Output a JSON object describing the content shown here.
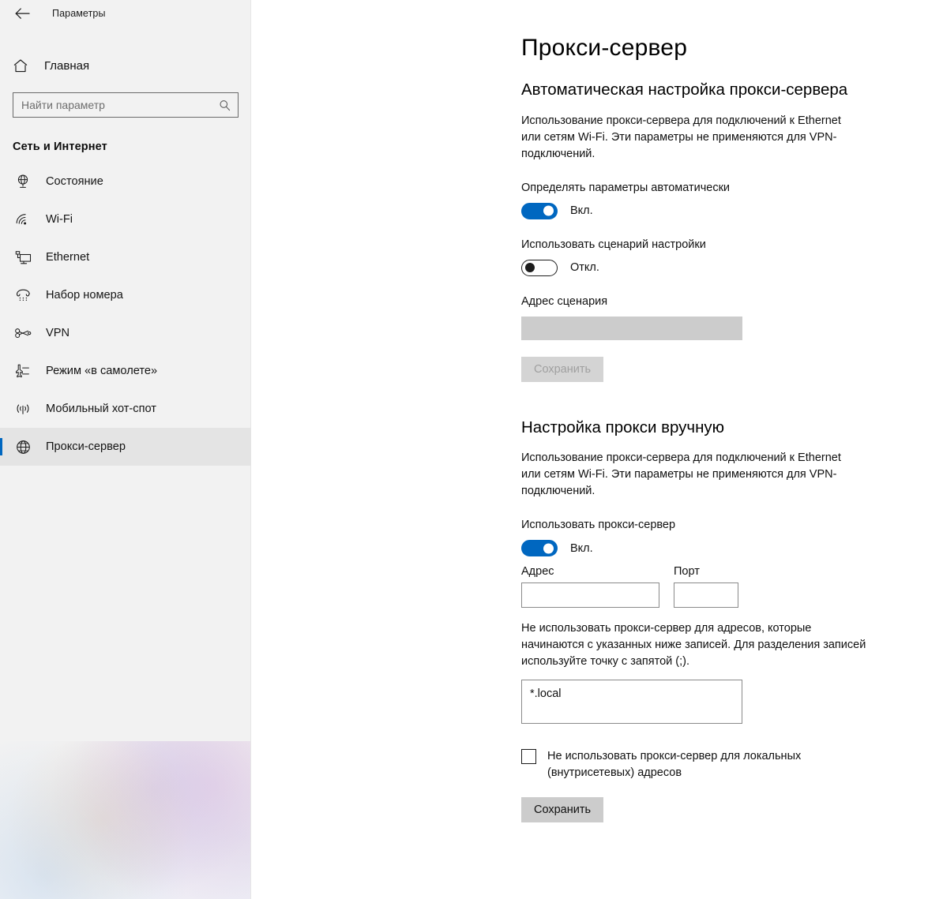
{
  "window": {
    "app_title": "Параметры",
    "back_icon": "back-arrow-icon"
  },
  "sidebar": {
    "home": {
      "label": "Главная",
      "icon": "home-icon"
    },
    "search": {
      "placeholder": "Найти параметр",
      "value": "",
      "icon": "search-icon"
    },
    "group_title": "Сеть и Интернет",
    "items": [
      {
        "label": "Состояние",
        "icon": "network-status-globe-icon",
        "selected": false
      },
      {
        "label": "Wi-Fi",
        "icon": "wifi-icon",
        "selected": false
      },
      {
        "label": "Ethernet",
        "icon": "ethernet-monitor-icon",
        "selected": false
      },
      {
        "label": "Набор номера",
        "icon": "dialup-phone-icon",
        "selected": false
      },
      {
        "label": "VPN",
        "icon": "vpn-key-icon",
        "selected": false
      },
      {
        "label": "Режим «в самолете»",
        "icon": "airplane-icon",
        "selected": false
      },
      {
        "label": "Мобильный хот-спот",
        "icon": "mobile-hotspot-icon",
        "selected": false
      },
      {
        "label": "Прокси-сервер",
        "icon": "proxy-globe-icon",
        "selected": true
      }
    ]
  },
  "main": {
    "page_title": "Прокси-сервер",
    "auto_section": {
      "heading": "Автоматическая настройка прокси-сервера",
      "description": "Использование прокси-сервера для подключений к Ethernet или сетям Wi-Fi. Эти параметры не применяются для VPN-подключений.",
      "detect_label": "Определять параметры автоматически",
      "detect_state": "Вкл.",
      "detect_on": true,
      "script_toggle_label": "Использовать сценарий настройки",
      "script_toggle_state": "Откл.",
      "script_on": false,
      "script_address_label": "Адрес сценария",
      "script_address_value": "",
      "save_label": "Сохранить",
      "save_enabled": false
    },
    "manual_section": {
      "heading": "Настройка прокси вручную",
      "description": "Использование прокси-сервера для подключений к Ethernet или сетям Wi-Fi. Эти параметры не применяются для VPN-подключений.",
      "use_proxy_label": "Использовать прокси-сервер",
      "use_proxy_state": "Вкл.",
      "use_proxy_on": true,
      "address_label": "Адрес",
      "address_value": "",
      "port_label": "Порт",
      "port_value": "",
      "bypass_description": "Не использовать прокси-сервер для адресов, которые начинаются с указанных ниже записей. Для разделения записей используйте точку с запятой (;).",
      "bypass_value": "*.local",
      "local_bypass_label": "Не использовать прокси-сервер для локальных (внутрисетевых) адресов",
      "local_bypass_checked": false,
      "save_label": "Сохранить",
      "save_enabled": true
    }
  },
  "colors": {
    "accent_blue": "#0067c0",
    "sidebar_bg": "#f2f2f2",
    "selected_bg": "#e4e4e4",
    "disabled_input": "#cccccc",
    "button_bg": "#cccccc"
  }
}
